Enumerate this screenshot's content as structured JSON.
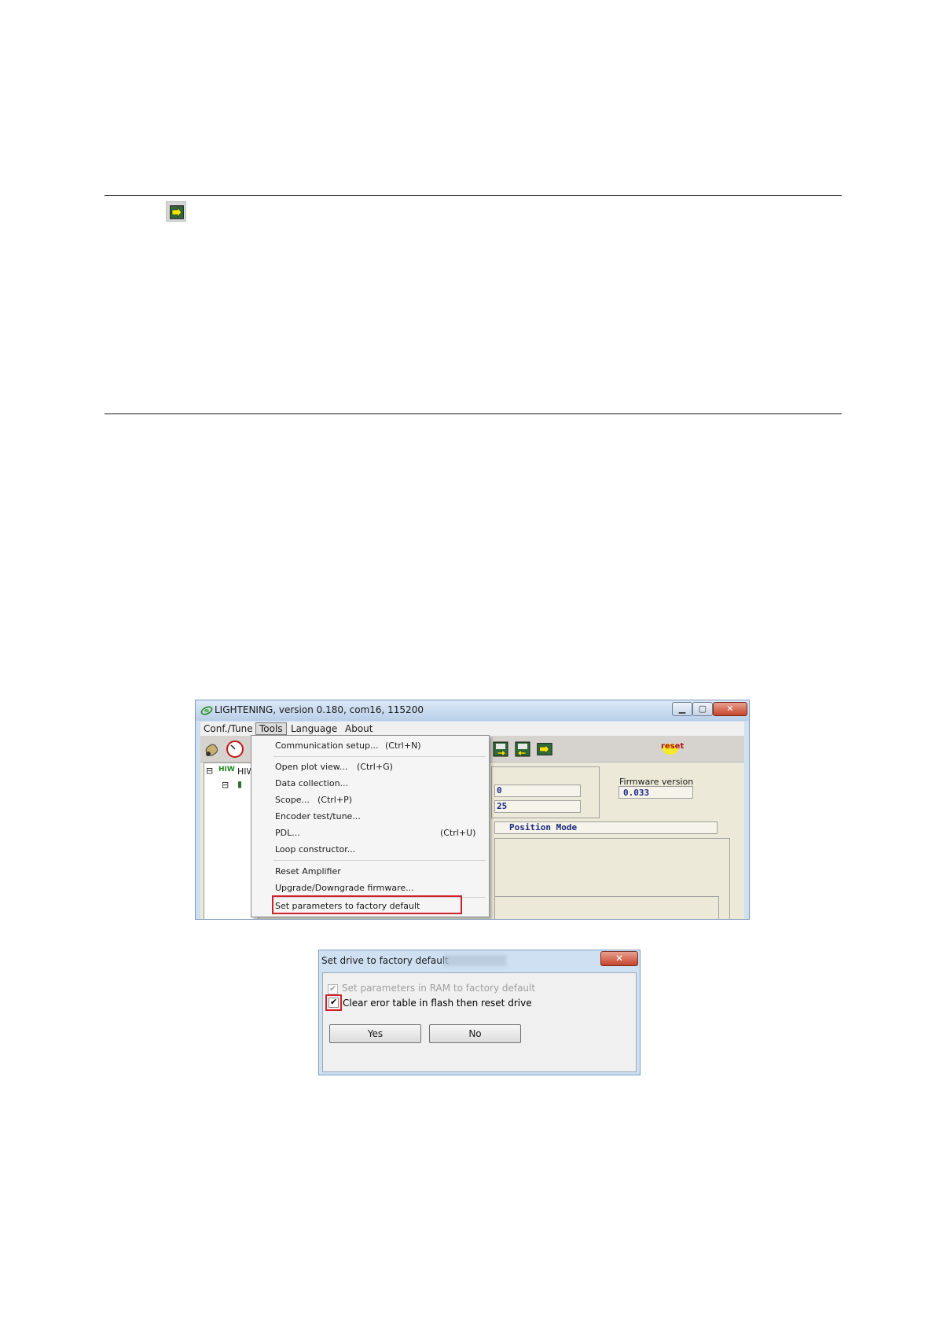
{
  "window": {
    "title": "LIGHTENING, version 0.180, com16, 115200",
    "menu": {
      "conf_tune": "Conf./Tune",
      "tools": "Tools",
      "language": "Language",
      "about": "About"
    },
    "toolbar": {
      "reset_label": "reset"
    },
    "tree": {
      "root_label": "HIW",
      "root_logo": "HIW"
    },
    "info": {
      "firmware_label": "Firmware version",
      "firmware_value": "0.033",
      "field_fragment_1": "0",
      "field_fragment_2": "25",
      "mode_text": "Position Mode"
    },
    "tools_menu": [
      {
        "label": "Communication setup...",
        "shortcut": "(Ctrl+N)"
      },
      {
        "label": "Open plot view...",
        "shortcut": "(Ctrl+G)"
      },
      {
        "label": "Data collection...",
        "shortcut": ""
      },
      {
        "label": "Scope...",
        "shortcut": "(Ctrl+P)"
      },
      {
        "label": "Encoder test/tune...",
        "shortcut": ""
      },
      {
        "label": "PDL...",
        "shortcut": "(Ctrl+U)"
      },
      {
        "label": "Loop constructor...",
        "shortcut": ""
      },
      {
        "label": "Reset Amplifier",
        "shortcut": ""
      },
      {
        "label": "Upgrade/Downgrade firmware...",
        "shortcut": ""
      },
      {
        "label": "Set parameters to factory default",
        "shortcut": ""
      }
    ]
  },
  "dialog": {
    "title": "Set drive to factory default",
    "option_ram": "Set parameters in RAM to factory default",
    "option_ram_checked": true,
    "option_ram_enabled": false,
    "option_flash": "Clear eror table in flash then reset drive",
    "option_flash_checked": true,
    "yes_label": "Yes",
    "no_label": "No"
  },
  "colors": {
    "highlight_box": "#d0202a",
    "value_text": "#1a2a80"
  }
}
